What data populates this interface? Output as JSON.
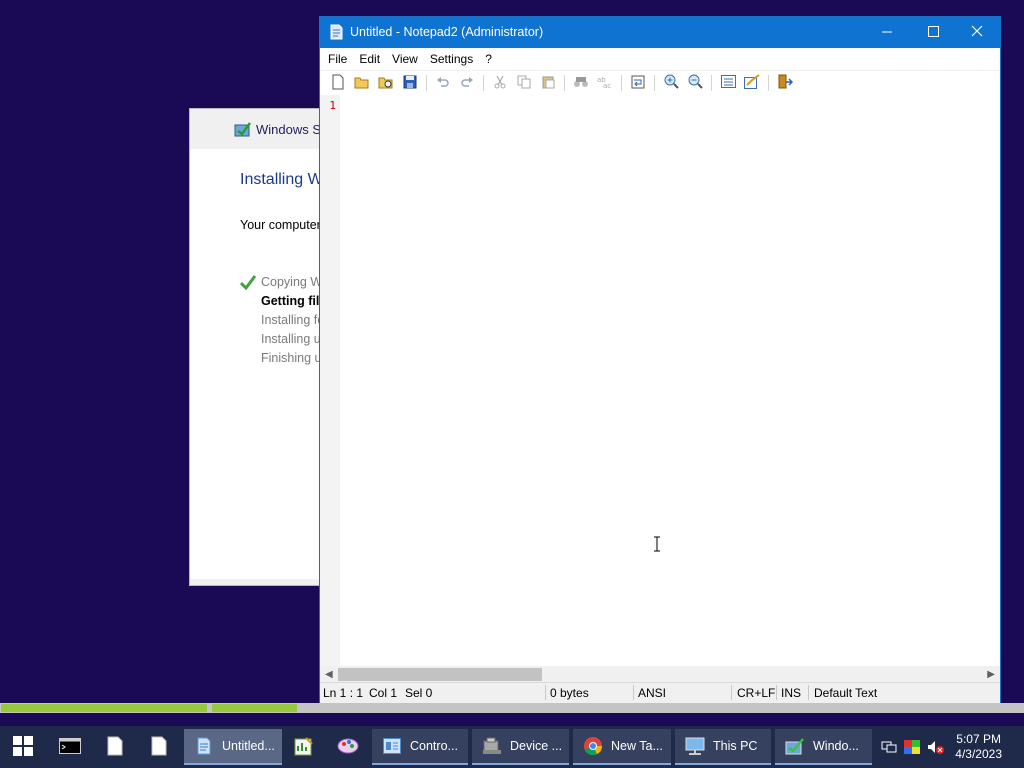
{
  "setup": {
    "title": "Windows Se",
    "heading": "Installing W",
    "description": "Your computer",
    "steps": [
      {
        "label": "Copying W",
        "state": "done"
      },
      {
        "label": "Getting fil",
        "state": "active"
      },
      {
        "label": "Installing fe",
        "state": "pending"
      },
      {
        "label": "Installing u",
        "state": "pending"
      },
      {
        "label": "Finishing u",
        "state": "pending"
      }
    ]
  },
  "notepad": {
    "title": "Untitled - Notepad2 (Administrator)",
    "menu": [
      "File",
      "Edit",
      "View",
      "Settings",
      "?"
    ],
    "toolbar_icons": [
      "new-file-icon",
      "open-folder-icon",
      "browse-icon",
      "save-icon",
      "undo-icon",
      "redo-icon",
      "cut-icon",
      "copy-icon",
      "paste-icon",
      "find-icon",
      "replace-icon",
      "wrap-icon",
      "zoom-in-icon",
      "zoom-out-icon",
      "scheme-icon",
      "settings-icon",
      "exit-icon"
    ],
    "line_number": "1",
    "status": {
      "position": "Ln 1 : 1",
      "col": "Col 1",
      "sel": "Sel 0",
      "size": "0 bytes",
      "encoding": "ANSI",
      "eol": "CR+LF",
      "mode": "INS",
      "scheme": "Default Text"
    }
  },
  "taskbar": {
    "tasks": [
      {
        "name": "notepad2",
        "label": "Untitled...",
        "active": true
      },
      {
        "name": "control-panel",
        "label": "Contro..."
      },
      {
        "name": "device-manager",
        "label": "Device ..."
      },
      {
        "name": "chrome",
        "label": "New Ta..."
      },
      {
        "name": "this-pc",
        "label": "This PC"
      },
      {
        "name": "windows-setup",
        "label": "Windo..."
      }
    ],
    "clock": {
      "time": "5:07 PM",
      "date": "4/3/2023"
    }
  },
  "colors": {
    "desktop": "#1a0a55",
    "titlebar": "#0f73d2",
    "progress": "#97c93c",
    "taskbar": "#1f2a4a"
  }
}
